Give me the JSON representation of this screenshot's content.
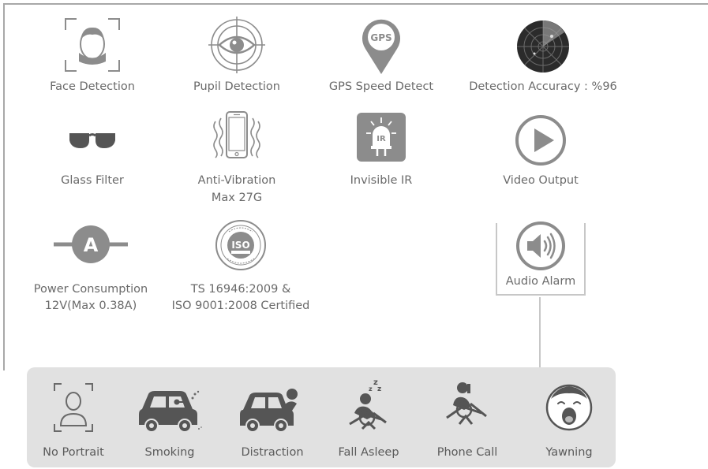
{
  "features": {
    "face_detection": "Face Detection",
    "pupil_detection": "Pupil Detection",
    "gps_speed_detect": "GPS Speed Detect",
    "gps_badge": "GPS",
    "detection_accuracy": "Detection Accuracy : %96",
    "glass_filter": "Glass Filter",
    "anti_vibration_line1": "Anti-Vibration",
    "anti_vibration_line2": "Max 27G",
    "invisible_ir": "Invisible IR",
    "ir_badge": "IR",
    "video_output": "Video Output",
    "power_consumption_line1": "Power Consumption",
    "power_consumption_line2": "12V(Max 0.38A)",
    "power_badge": "A",
    "certification_line1": "TS 16946:2009 &",
    "certification_line2": "ISO 9001:2008 Certified",
    "iso_badge": "ISO",
    "audio_alarm": "Audio Alarm"
  },
  "alarms": {
    "no_portrait": "No Portrait",
    "smoking": "Smoking",
    "distraction": "Distraction",
    "fall_asleep": "Fall Asleep",
    "phone_call": "Phone Call",
    "yawning": "Yawning"
  },
  "colors": {
    "icon_gray": "#8c8c8c",
    "text_gray": "#6a6a6a",
    "panel_bg": "#e1e1e1",
    "frame_line": "#a8a8a8"
  },
  "icons": [
    "face-scan-icon",
    "eye-target-icon",
    "gps-pin-icon",
    "radar-icon",
    "sunglasses-icon",
    "vibrating-phone-icon",
    "ir-led-icon",
    "play-icon",
    "power-a-icon",
    "iso-seal-icon",
    "speaker-icon",
    "portrait-scan-icon",
    "car-smoking-icon",
    "car-distraction-icon",
    "driver-asleep-icon",
    "driver-phone-icon",
    "yawning-face-icon"
  ]
}
